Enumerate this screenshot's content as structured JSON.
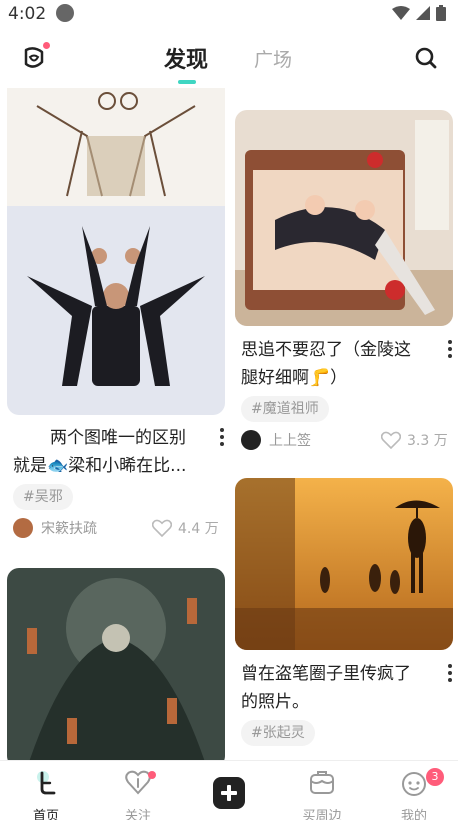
{
  "status_bar": {
    "time": "4:02"
  },
  "header": {
    "tabs": [
      {
        "label": "发现",
        "active": true
      },
      {
        "label": "广场",
        "active": false
      }
    ]
  },
  "feed": {
    "left": [
      {
        "title_line1": "两个图唯一的区别",
        "title_line2": "就是🐟梁和小晞在比...",
        "tag": "#吴邪",
        "author": "宋簌扶疏",
        "likes": "4.4 万"
      },
      {
        "title_line1": "",
        "title_line2": ""
      }
    ],
    "right": [
      {
        "title_line1": "思追不要忍了（金陵这",
        "title_line2": "腿好细啊🦵）",
        "tag": "#魔道祖师",
        "author": "上上签",
        "likes": "3.3 万"
      },
      {
        "title_line1": "曾在盗笔圈子里传疯了",
        "title_line2": "的照片。",
        "tag": "#张起灵"
      }
    ]
  },
  "nav": {
    "items": [
      {
        "label": "首页",
        "active": true
      },
      {
        "label": "关注",
        "active": false
      },
      {
        "label": "",
        "active": false
      },
      {
        "label": "买周边",
        "active": false
      },
      {
        "label": "我的",
        "active": false
      }
    ],
    "profile_badge": "3"
  },
  "colors": {
    "accent": "#3fd6c2",
    "badge": "#ff5c7a"
  }
}
